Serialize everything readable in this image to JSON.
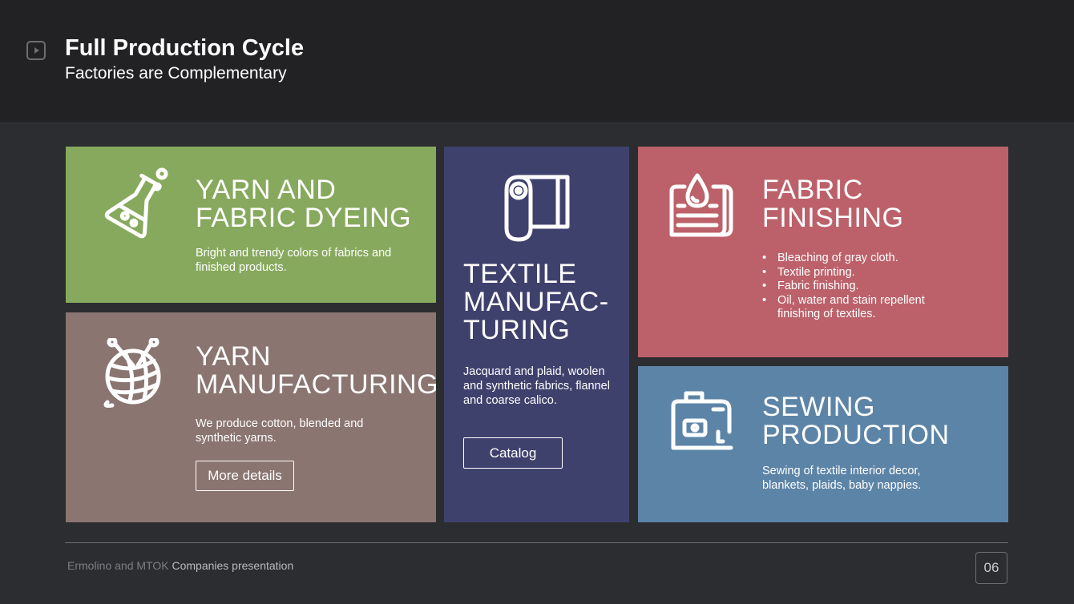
{
  "header": {
    "title": "Full Production Cycle",
    "subtitle": "Factories are Complementary",
    "play_icon": "play-icon"
  },
  "cards": {
    "dyeing": {
      "icon": "flask-icon",
      "title_line1": "YARN AND",
      "title_line2": "FABRIC DYEING",
      "description": "Bright and trendy colors of fabrics and finished products.",
      "color": "#87a95d"
    },
    "yarn": {
      "icon": "yarn-ball-icon",
      "title_line1": "YARN",
      "title_line2": "MANUFACTURING",
      "description": "We produce cotton, blended and synthetic yarns.",
      "button_label": "More details",
      "color": "#8a7570"
    },
    "textile": {
      "icon": "fabric-roll-icon",
      "title_line1": "TEXTILE",
      "title_line2": "MANUFAC-",
      "title_line3": "TURING",
      "description": "Jacquard and plaid, woolen and synthetic fabrics, flannel and coarse calico.",
      "button_label": "Catalog",
      "color": "#3f416d"
    },
    "finishing": {
      "icon": "dye-drop-icon",
      "title_line1": "FABRIC",
      "title_line2": "FINISHING",
      "bullets": [
        "Bleaching of gray cloth.",
        "Textile printing.",
        "Fabric finishing.",
        "Oil, water and stain repellent finishing of textiles."
      ],
      "color": "#bc616a"
    },
    "sewing": {
      "icon": "sewing-machine-icon",
      "title_line1": "SEWING",
      "title_line2": "PRODUCTION",
      "description": "Sewing of textile interior decor, blankets, plaids, baby nappies.",
      "color": "#5c84a7"
    }
  },
  "footer": {
    "text_muted": "Ermolino and MTOK",
    "text_bright": "Companies presentation",
    "page_number": "06"
  }
}
